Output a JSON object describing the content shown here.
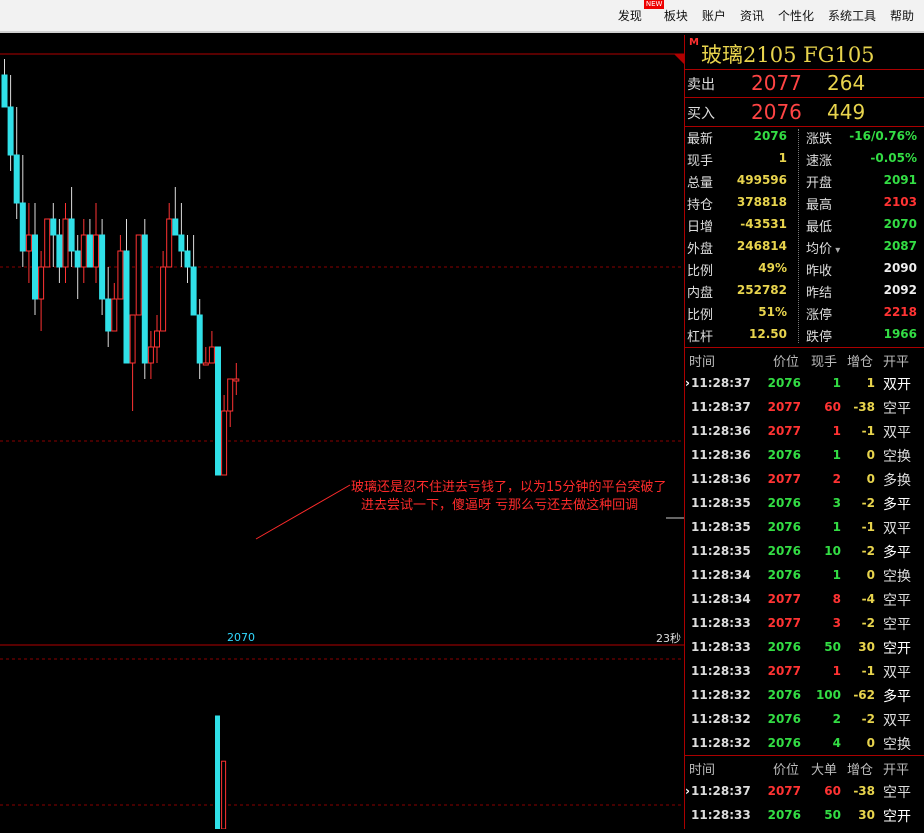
{
  "menu": {
    "items": [
      "发现",
      "板块",
      "账户",
      "资讯",
      "个性化",
      "系统工具",
      "帮助"
    ],
    "new_badge": "NEW"
  },
  "colors": {
    "up": "#ff3333",
    "down": "#30e0e8",
    "green": "#33dd44",
    "yellow": "#e8d44d",
    "grid": "#a00000"
  },
  "chart": {
    "annotation_line1": "玻璃还是忍不住进去亏钱了，以为15分钟的平台突破了",
    "annotation_line2": "进去尝试一下，傻逼呀  亏那么亏还去做这种回调",
    "low_label": "2070",
    "seconds_label": "23秒"
  },
  "quote": {
    "marker": "M",
    "title": "玻璃2105  FG105",
    "sell_label": "卖出",
    "sell_price": "2077",
    "sell_vol": "264",
    "buy_label": "买入",
    "buy_price": "2076",
    "buy_vol": "449",
    "stats": [
      {
        "l1": "最新",
        "v1": "2076",
        "c1": "green",
        "l2": "涨跌",
        "v2": "-16/0.76%",
        "c2": "green"
      },
      {
        "l1": "现手",
        "v1": "1",
        "c1": "yellow",
        "l2": "速涨",
        "v2": "-0.05%",
        "c2": "green"
      },
      {
        "l1": "总量",
        "v1": "499596",
        "c1": "yellow",
        "l2": "开盘",
        "v2": "2091",
        "c2": "green"
      },
      {
        "l1": "持仓",
        "v1": "378818",
        "c1": "yellow",
        "l2": "最高",
        "v2": "2103",
        "c2": "red"
      },
      {
        "l1": "日增",
        "v1": "-43531",
        "c1": "yellow",
        "l2": "最低",
        "v2": "2070",
        "c2": "green"
      },
      {
        "l1": "外盘",
        "v1": "246814",
        "c1": "yellow",
        "l2": "均价",
        "v2": "2087",
        "c2": "green"
      },
      {
        "l1": "比例",
        "v1": "49%",
        "c1": "yellow",
        "l2": "昨收",
        "v2": "2090",
        "c2": "white"
      },
      {
        "l1": "内盘",
        "v1": "252782",
        "c1": "yellow",
        "l2": "昨结",
        "v2": "2092",
        "c2": "white"
      },
      {
        "l1": "比例",
        "v1": "51%",
        "c1": "yellow",
        "l2": "涨停",
        "v2": "2218",
        "c2": "red"
      },
      {
        "l1": "杠杆",
        "v1": "12.50",
        "c1": "yellow",
        "l2": "跌停",
        "v2": "1966",
        "c2": "green"
      }
    ]
  },
  "ticks": {
    "headers": [
      "时间",
      "价位",
      "现手",
      "增仓",
      "开平"
    ],
    "rows": [
      {
        "time": "11:28:37",
        "price": "2076",
        "qty": "1",
        "oi": "1",
        "type": "双开",
        "sel": true
      },
      {
        "time": "11:28:37",
        "price": "2077",
        "qty": "60",
        "oi": "-38",
        "type": "空平"
      },
      {
        "time": "11:28:36",
        "price": "2077",
        "qty": "1",
        "oi": "-1",
        "type": "双平"
      },
      {
        "time": "11:28:36",
        "price": "2076",
        "qty": "1",
        "oi": "0",
        "type": "空换"
      },
      {
        "time": "11:28:36",
        "price": "2077",
        "qty": "2",
        "oi": "0",
        "type": "多换"
      },
      {
        "time": "11:28:35",
        "price": "2076",
        "qty": "3",
        "oi": "-2",
        "type": "多平"
      },
      {
        "time": "11:28:35",
        "price": "2076",
        "qty": "1",
        "oi": "-1",
        "type": "双平"
      },
      {
        "time": "11:28:35",
        "price": "2076",
        "qty": "10",
        "oi": "-2",
        "type": "多平"
      },
      {
        "time": "11:28:34",
        "price": "2076",
        "qty": "1",
        "oi": "0",
        "type": "空换"
      },
      {
        "time": "11:28:34",
        "price": "2077",
        "qty": "8",
        "oi": "-4",
        "type": "空平"
      },
      {
        "time": "11:28:33",
        "price": "2077",
        "qty": "3",
        "oi": "-2",
        "type": "空平"
      },
      {
        "time": "11:28:33",
        "price": "2076",
        "qty": "50",
        "oi": "30",
        "type": "空开"
      },
      {
        "time": "11:28:33",
        "price": "2077",
        "qty": "1",
        "oi": "-1",
        "type": "双平"
      },
      {
        "time": "11:28:32",
        "price": "2076",
        "qty": "100",
        "oi": "-62",
        "type": "多平"
      },
      {
        "time": "11:28:32",
        "price": "2076",
        "qty": "2",
        "oi": "-2",
        "type": "双平"
      },
      {
        "time": "11:28:32",
        "price": "2076",
        "qty": "4",
        "oi": "0",
        "type": "空换"
      }
    ]
  },
  "big_orders": {
    "headers": [
      "时间",
      "价位",
      "大单",
      "增仓",
      "开平"
    ],
    "rows": [
      {
        "time": "11:28:37",
        "price": "2077",
        "qty": "60",
        "oi": "-38",
        "type": "空平",
        "sel": true
      },
      {
        "time": "11:28:33",
        "price": "2076",
        "qty": "50",
        "oi": "30",
        "type": "空开"
      }
    ]
  },
  "candles": [
    {
      "o": 2095,
      "h": 2096,
      "l": 2093,
      "c": 2093
    },
    {
      "o": 2093,
      "h": 2095,
      "l": 2089,
      "c": 2090
    },
    {
      "o": 2090,
      "h": 2093,
      "l": 2086,
      "c": 2087
    },
    {
      "o": 2087,
      "h": 2090,
      "l": 2083,
      "c": 2084
    },
    {
      "o": 2084,
      "h": 2087,
      "l": 2082,
      "c": 2085
    },
    {
      "o": 2085,
      "h": 2087,
      "l": 2080,
      "c": 2081
    },
    {
      "o": 2081,
      "h": 2084,
      "l": 2079,
      "c": 2083
    },
    {
      "o": 2083,
      "h": 2086,
      "l": 2083,
      "c": 2086
    },
    {
      "o": 2086,
      "h": 2087,
      "l": 2083,
      "c": 2085
    },
    {
      "o": 2085,
      "h": 2086,
      "l": 2082,
      "c": 2083
    },
    {
      "o": 2083,
      "h": 2087,
      "l": 2082,
      "c": 2086
    },
    {
      "o": 2086,
      "h": 2088,
      "l": 2083,
      "c": 2084
    },
    {
      "o": 2084,
      "h": 2085,
      "l": 2081,
      "c": 2083
    },
    {
      "o": 2083,
      "h": 2086,
      "l": 2082,
      "c": 2085
    },
    {
      "o": 2085,
      "h": 2086,
      "l": 2083,
      "c": 2083
    },
    {
      "o": 2083,
      "h": 2087,
      "l": 2082,
      "c": 2085
    },
    {
      "o": 2085,
      "h": 2086,
      "l": 2080,
      "c": 2081
    },
    {
      "o": 2081,
      "h": 2083,
      "l": 2078,
      "c": 2079
    },
    {
      "o": 2079,
      "h": 2082,
      "l": 2079,
      "c": 2081
    },
    {
      "o": 2081,
      "h": 2085,
      "l": 2081,
      "c": 2084
    },
    {
      "o": 2084,
      "h": 2086,
      "l": 2077,
      "c": 2077
    },
    {
      "o": 2077,
      "h": 2080,
      "l": 2074,
      "c": 2080
    },
    {
      "o": 2080,
      "h": 2085,
      "l": 2080,
      "c": 2085
    },
    {
      "o": 2085,
      "h": 2086,
      "l": 2076,
      "c": 2077
    },
    {
      "o": 2077,
      "h": 2079,
      "l": 2076,
      "c": 2078
    },
    {
      "o": 2078,
      "h": 2080,
      "l": 2077,
      "c": 2079
    },
    {
      "o": 2079,
      "h": 2084,
      "l": 2079,
      "c": 2083
    },
    {
      "o": 2083,
      "h": 2087,
      "l": 2083,
      "c": 2086
    },
    {
      "o": 2086,
      "h": 2088,
      "l": 2085,
      "c": 2085
    },
    {
      "o": 2085,
      "h": 2087,
      "l": 2083,
      "c": 2084
    },
    {
      "o": 2084,
      "h": 2085,
      "l": 2082,
      "c": 2083
    },
    {
      "o": 2083,
      "h": 2085,
      "l": 2080,
      "c": 2080
    },
    {
      "o": 2080,
      "h": 2081,
      "l": 2076,
      "c": 2077
    },
    {
      "o": 2077,
      "h": 2078,
      "l": 2077,
      "c": 2077
    },
    {
      "o": 2077,
      "h": 2079,
      "l": 2077,
      "c": 2078
    },
    {
      "o": 2078,
      "h": 2078,
      "l": 2070,
      "c": 2070
    },
    {
      "o": 2070,
      "h": 2075,
      "l": 2070,
      "c": 2074
    },
    {
      "o": 2074,
      "h": 2076,
      "l": 2073,
      "c": 2076
    },
    {
      "o": 2076,
      "h": 2077,
      "l": 2075,
      "c": 2076
    }
  ],
  "volume": [
    {
      "v": 100,
      "d": "down"
    },
    {
      "v": 60,
      "d": "up"
    }
  ]
}
